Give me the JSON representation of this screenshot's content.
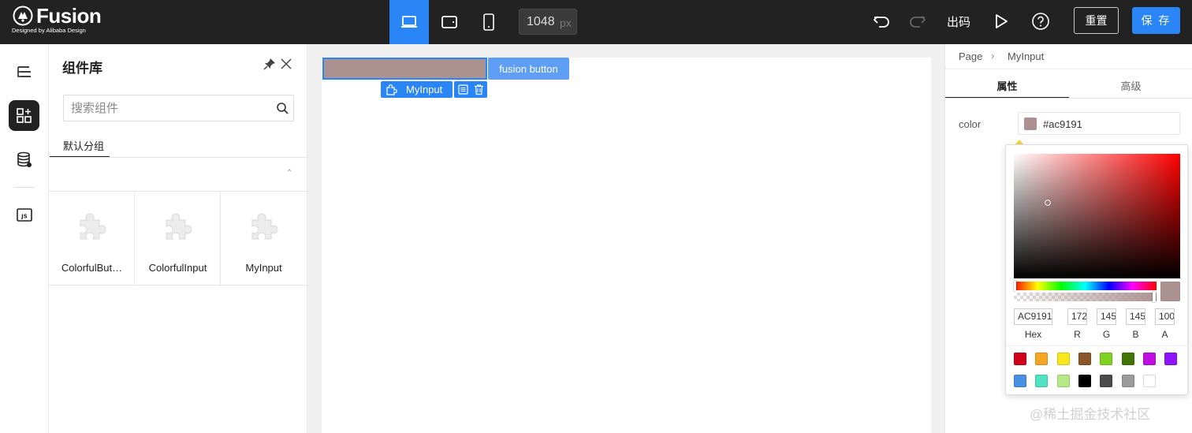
{
  "app": {
    "brand_name": "Fusion",
    "brand_tagline": "Designed by Alibaba Design"
  },
  "toolbar": {
    "devices": [
      {
        "name": "desktop",
        "icon": "laptop-icon",
        "active": true
      },
      {
        "name": "tablet",
        "icon": "tablet-icon",
        "active": false
      },
      {
        "name": "phone",
        "icon": "phone-icon",
        "active": false
      }
    ],
    "canvas_width_value": "1048",
    "canvas_width_unit": "px",
    "undo_icon": "undo-icon",
    "redo_icon": "redo-icon",
    "export_label": "出码",
    "preview_icon": "play-icon",
    "help_icon": "help-circle-icon",
    "reset_label": "重置",
    "save_label": "保 存",
    "accent_color": "#2a85f7"
  },
  "rail": {
    "items": [
      {
        "icon": "outline-tree-icon",
        "active": false
      },
      {
        "icon": "component-library-icon",
        "active": true
      },
      {
        "icon": "datasource-icon",
        "active": false
      },
      {
        "icon": "js-code-icon",
        "active": false
      }
    ]
  },
  "component_panel": {
    "title": "组件库",
    "search_placeholder": "搜索组件",
    "group_tab": "默认分组",
    "collapse_glyph": "⌃",
    "components": [
      {
        "label": "ColorfulBut…",
        "icon": "puzzle-piece-icon"
      },
      {
        "label": "ColorfulInput",
        "icon": "puzzle-piece-icon"
      },
      {
        "label": "MyInput",
        "icon": "puzzle-piece-icon"
      }
    ]
  },
  "canvas": {
    "selected_component_label": "MyInput",
    "selected_component_color": "#ac9191",
    "button_text": "fusion button",
    "button_color": "#5e9ef5"
  },
  "settings": {
    "breadcrumb": {
      "page": "Page",
      "separator": "›",
      "node": "MyInput"
    },
    "tabs": [
      {
        "label": "属性",
        "active": true
      },
      {
        "label": "高级",
        "active": false
      }
    ],
    "color_prop_label": "color",
    "color_value": "#ac9191"
  },
  "color_picker": {
    "current_color": "#ac9191",
    "fields": {
      "hex": {
        "value": "AC9191",
        "label": "Hex"
      },
      "r": {
        "value": "172",
        "label": "R"
      },
      "g": {
        "value": "145",
        "label": "G"
      },
      "b": {
        "value": "145",
        "label": "B"
      },
      "a": {
        "value": "100",
        "label": "A"
      }
    },
    "presets": [
      "#d0021b",
      "#f5a623",
      "#f8e71c",
      "#8b572a",
      "#7ed321",
      "#417505",
      "#bd10e0",
      "#9013fe",
      "#4a90e2",
      "#50e3c2",
      "#b8e986",
      "#000000",
      "#4a4a4a",
      "#9b9b9b",
      "#ffffff"
    ]
  },
  "watermark": "@稀土掘金技术社区"
}
